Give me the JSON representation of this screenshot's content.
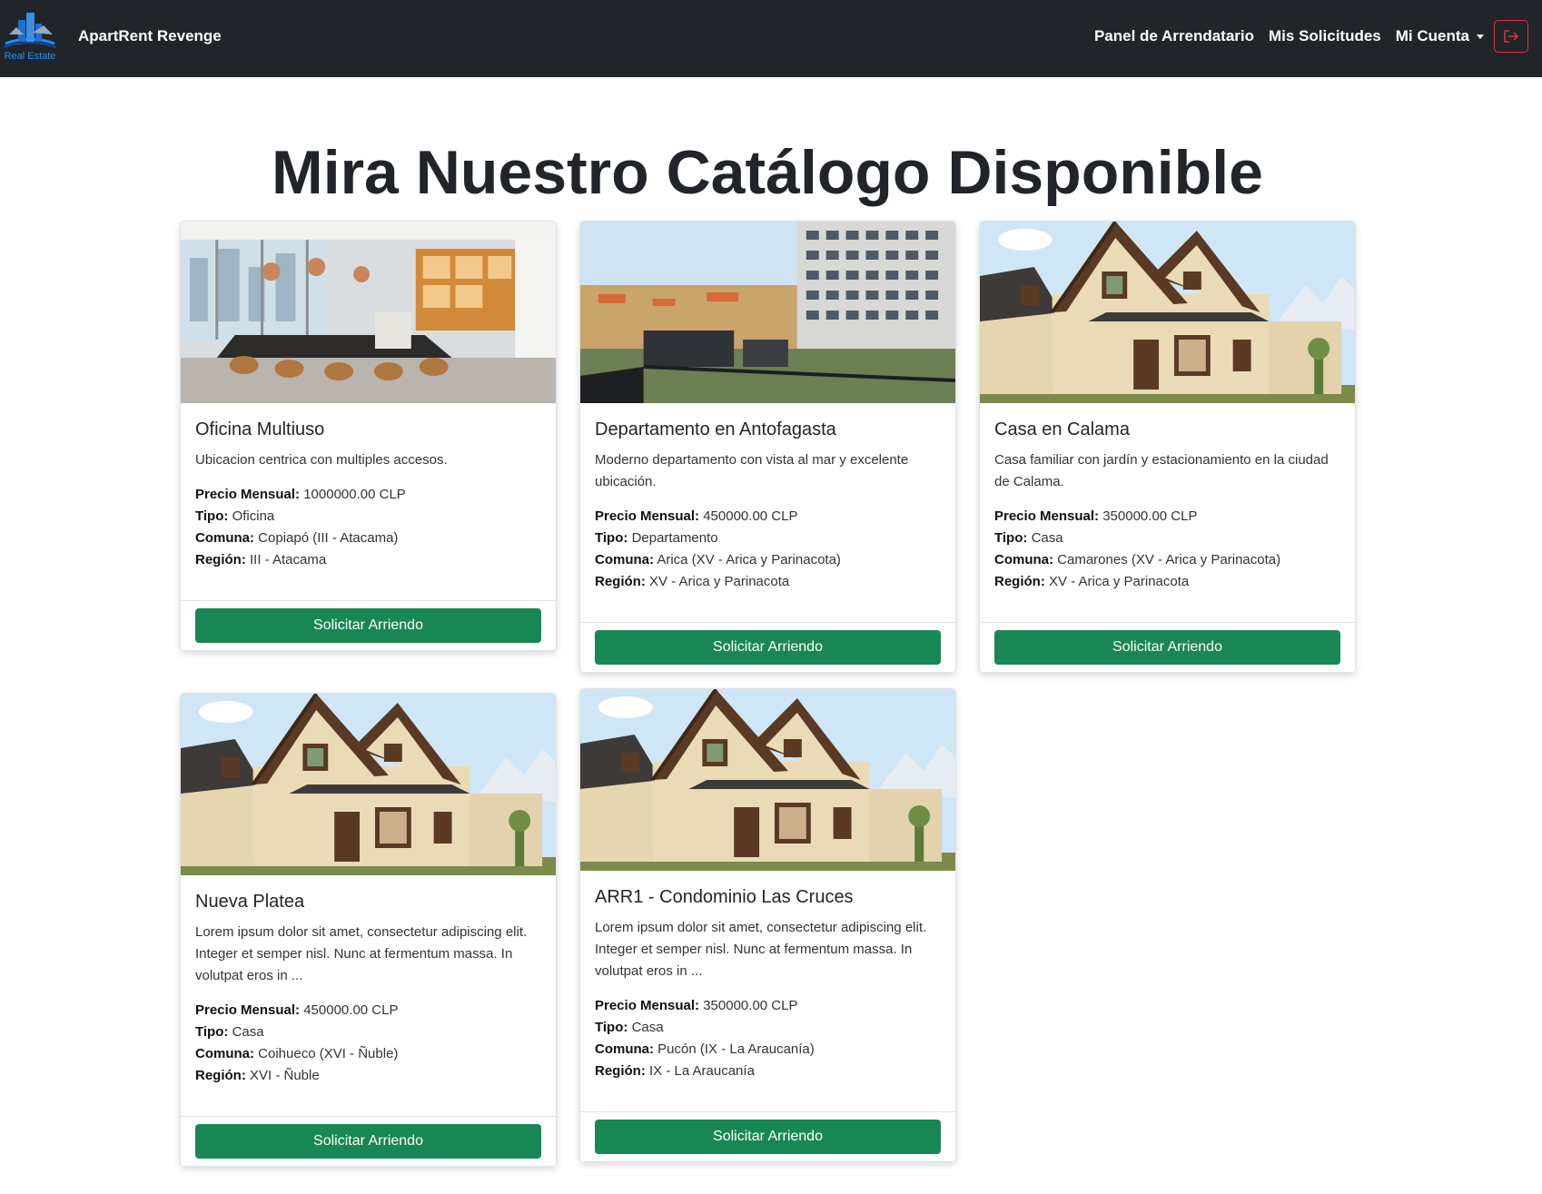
{
  "nav": {
    "brand_logo_text": "Real Estate",
    "brand_name": "ApartRent Revenge",
    "links": [
      "Panel de Arrendatario",
      "Mis Solicitudes",
      "Mi Cuenta"
    ],
    "logout_icon": "logout-icon"
  },
  "page": {
    "title": "Mira Nuestro Catálogo Disponible"
  },
  "labels": {
    "price": "Precio Mensual:",
    "type": "Tipo:",
    "comuna": "Comuna:",
    "region": "Región:",
    "button": "Solicitar Arriendo"
  },
  "cards": [
    {
      "image": "office-interior",
      "title": "Oficina Multiuso",
      "description": "Ubicacion centrica con multiples accesos.",
      "price": "1000000.00 CLP",
      "type": "Oficina",
      "comuna": "Copiapó (III - Atacama)",
      "region": "III - Atacama"
    },
    {
      "image": "apartment-building",
      "title": "Departamento en Antofagasta",
      "description": "Moderno departamento con vista al mar y excelente ubicación.",
      "price": "450000.00 CLP",
      "type": "Departamento",
      "comuna": "Arica (XV - Arica y Parinacota)",
      "region": "XV - Arica y Parinacota"
    },
    {
      "image": "house",
      "title": "Casa en Calama",
      "description": "Casa familiar con jardín y estacionamiento en la ciudad de Calama.",
      "price": "350000.00 CLP",
      "type": "Casa",
      "comuna": "Camarones (XV - Arica y Parinacota)",
      "region": "XV - Arica y Parinacota"
    },
    {
      "image": "house",
      "title": "Nueva Platea",
      "description": "Lorem ipsum dolor sit amet, consectetur adipiscing elit. Integer et semper nisl. Nunc at fermentum massa. In volutpat eros in ...",
      "price": "450000.00 CLP",
      "type": "Casa",
      "comuna": "Coihueco (XVI - Ñuble)",
      "region": "XVI - Ñuble"
    },
    {
      "image": "house",
      "title": "ARR1 - Condominio Las Cruces",
      "description": "Lorem ipsum dolor sit amet, consectetur adipiscing elit. Integer et semper nisl. Nunc at fermentum massa. In volutpat eros in ...",
      "price": "350000.00 CLP",
      "type": "Casa",
      "comuna": "Pucón (IX - La Araucanía)",
      "region": "IX - La Araucanía"
    }
  ]
}
